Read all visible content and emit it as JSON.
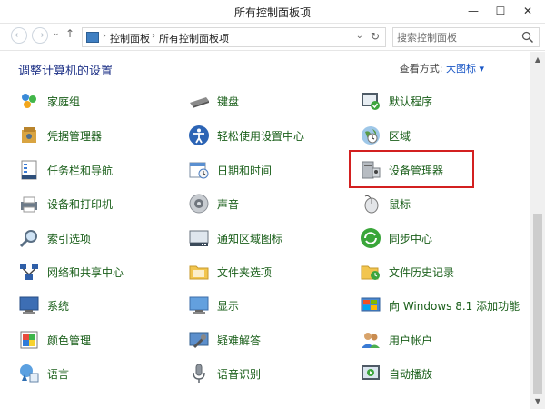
{
  "window": {
    "title": "所有控制面板项",
    "minimize": "—",
    "maximize": "☐",
    "close": "✕"
  },
  "address": {
    "breadcrumbs": [
      "控制面板",
      "所有控制面板项"
    ],
    "separator": "›",
    "dropdown": "⌄",
    "refresh": "↻",
    "search_placeholder": "搜索控制面板"
  },
  "nav": {
    "back": "←",
    "forward": "→",
    "recent": "⌄",
    "up": "↑"
  },
  "header": {
    "title": "调整计算机的设置",
    "view_by_label": "查看方式:",
    "view_by_value": "大图标 ▾"
  },
  "items": [
    [
      "家庭组",
      "键盘",
      "默认程序"
    ],
    [
      "凭据管理器",
      "轻松使用设置中心",
      "区域"
    ],
    [
      "任务栏和导航",
      "日期和时间",
      "设备管理器"
    ],
    [
      "设备和打印机",
      "声音",
      "鼠标"
    ],
    [
      "索引选项",
      "通知区域图标",
      "同步中心"
    ],
    [
      "网络和共享中心",
      "文件夹选项",
      "文件历史记录"
    ],
    [
      "系统",
      "显示",
      "向 Windows 8.1 添加功能"
    ],
    [
      "颜色管理",
      "疑难解答",
      "用户帐户"
    ],
    [
      "语言",
      "语音识别",
      "自动播放"
    ]
  ],
  "scroll": {
    "up": "▲",
    "down": "▼"
  }
}
